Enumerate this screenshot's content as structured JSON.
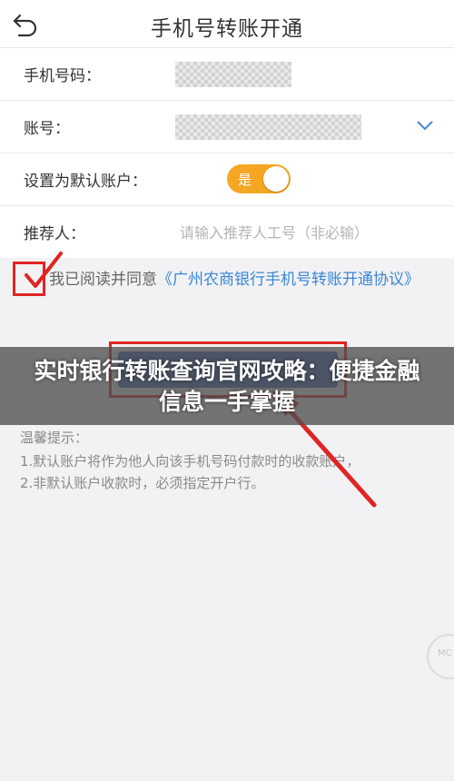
{
  "header": {
    "title": "手机号转账开通",
    "back_icon": "back-arrow-icon"
  },
  "form": {
    "phone_label": "手机号码：",
    "account_label": "账号：",
    "default_label": "设置为默认账户：",
    "toggle_text": "是",
    "toggle_on": true,
    "referrer_label": "推荐人：",
    "referrer_placeholder": "请输入推荐人工号（非必输）"
  },
  "agreement": {
    "prefix": "我已阅读并同意",
    "link": "《广州农商银行手机号转账开通协议》",
    "checked": true
  },
  "tips": {
    "title": "温馨提示：",
    "items": [
      "1.默认账户将作为他人向该手机号码付款时的收款账户，",
      "2.非默认账户收款时，必须指定开户行。"
    ]
  },
  "overlay": {
    "headline": "实时银行转账查询官网攻略：便捷金融信息一手掌握"
  },
  "colors": {
    "accent": "#f5a623",
    "link": "#3a86d6",
    "annotation": "#e02424",
    "button": "#3f6ab4"
  }
}
